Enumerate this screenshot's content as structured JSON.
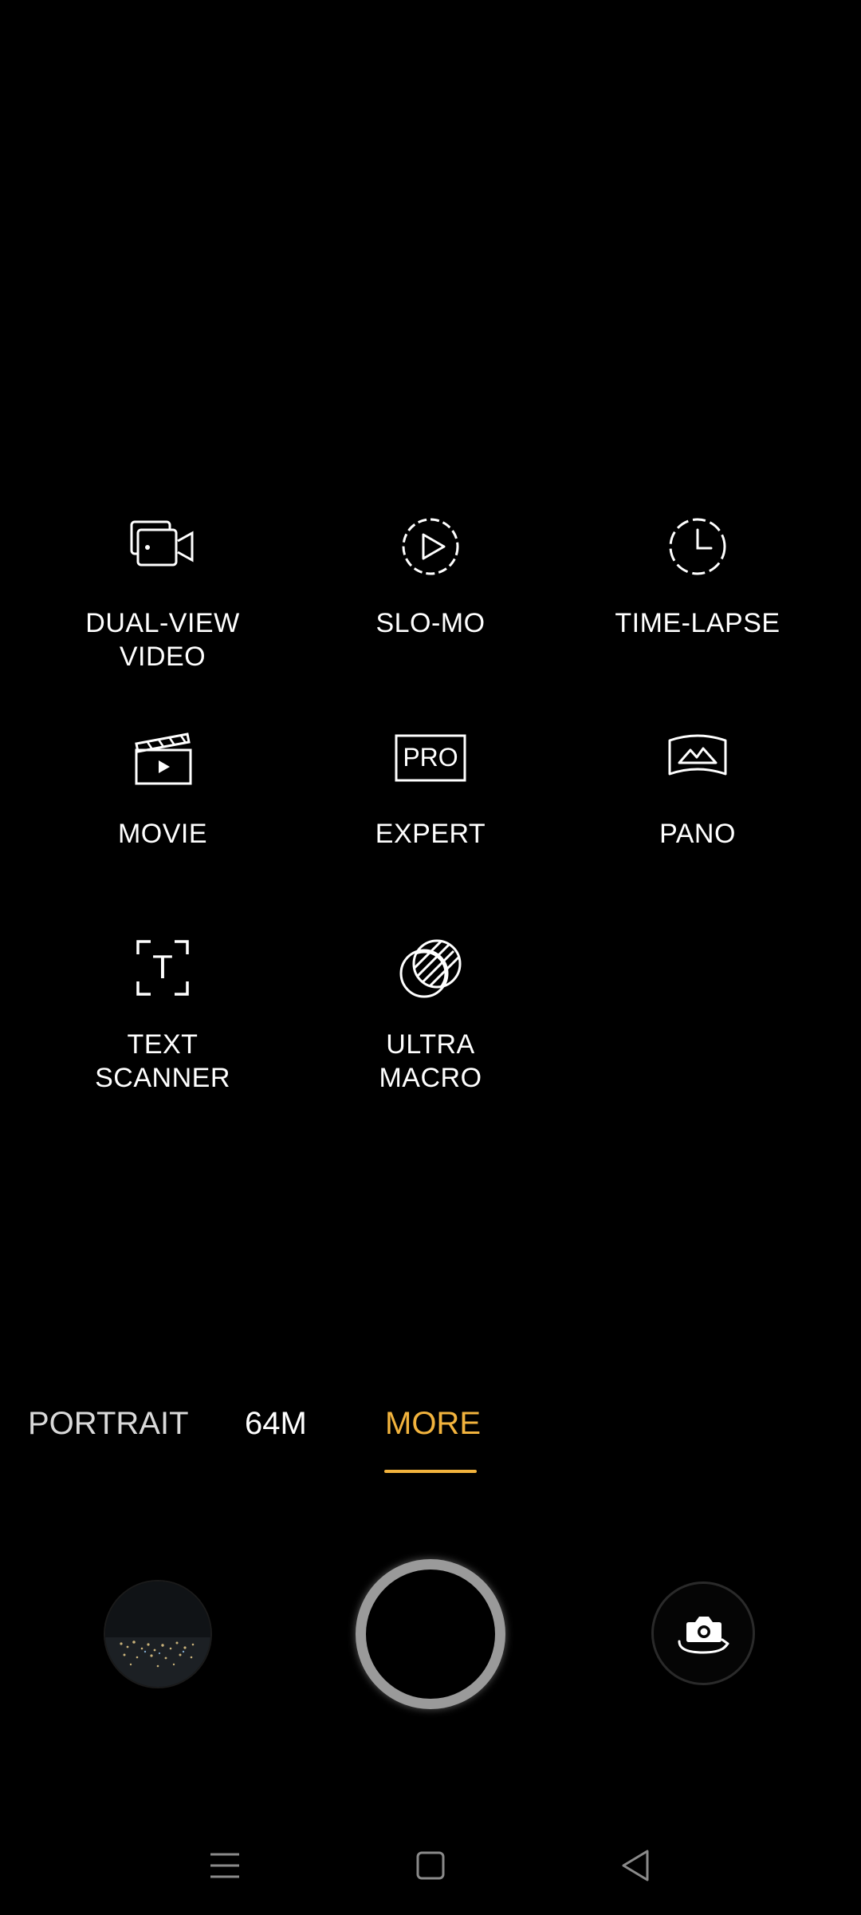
{
  "modes_grid": {
    "items": [
      {
        "id": "dual-view-video",
        "label": "DUAL-VIEW\nVIDEO",
        "icon": "dual-view-video-icon"
      },
      {
        "id": "slo-mo",
        "label": "SLO-MO",
        "icon": "slo-mo-icon"
      },
      {
        "id": "time-lapse",
        "label": "TIME-LAPSE",
        "icon": "time-lapse-icon"
      },
      {
        "id": "movie",
        "label": "MOVIE",
        "icon": "movie-clapperboard-icon"
      },
      {
        "id": "expert",
        "label": "EXPERT",
        "icon": "pro-icon",
        "icon_text": "PRO"
      },
      {
        "id": "pano",
        "label": "PANO",
        "icon": "panorama-icon"
      },
      {
        "id": "text-scanner",
        "label": "TEXT\nSCANNER",
        "icon": "text-scanner-icon",
        "icon_text": "T"
      },
      {
        "id": "ultra-macro",
        "label": "ULTRA\nMACRO",
        "icon": "ultra-macro-icon"
      }
    ]
  },
  "mode_strip": {
    "items": [
      "PORTRAIT",
      "64M",
      "MORE"
    ],
    "selected": "MORE"
  },
  "controls": {
    "gallery": "gallery-thumbnail",
    "shutter": "shutter",
    "switch_camera": "switch-camera-icon"
  },
  "nav_bar": {
    "menu": "menu-icon",
    "home": "home-icon",
    "back": "back-icon"
  },
  "colors": {
    "background": "#000000",
    "text": "#ffffff",
    "accent": "#f2b33d",
    "shutter_ring": "#9a9a9a"
  }
}
